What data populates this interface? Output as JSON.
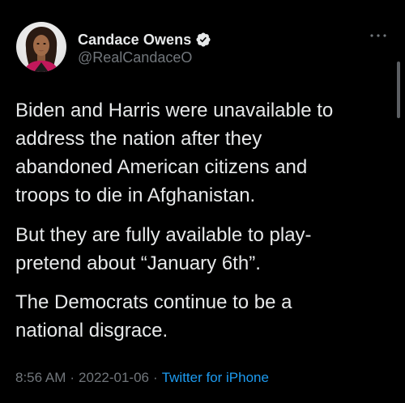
{
  "tweet": {
    "author": {
      "display_name": "Candace Owens",
      "handle": "@RealCandaceO",
      "verified": true
    },
    "paragraphs": [
      "Biden and Harris were unavailable to\naddress the nation after they\nabandoned American citizens and\ntroops to die in Afghanistan.",
      "But they are fully available to play-\npretend about “January 6th”.",
      "The Democrats continue to be a\nnational disgrace."
    ],
    "meta": {
      "time": "8:56 AM",
      "separator": "·",
      "date": "2022-01-06",
      "source": "Twitter for iPhone"
    }
  },
  "icons": {
    "verified": "verified-badge-icon",
    "more": "more-options-icon"
  },
  "colors": {
    "background": "#000000",
    "text": "#e7e9ea",
    "secondary": "#71767b",
    "accent": "#1d9bf0"
  }
}
